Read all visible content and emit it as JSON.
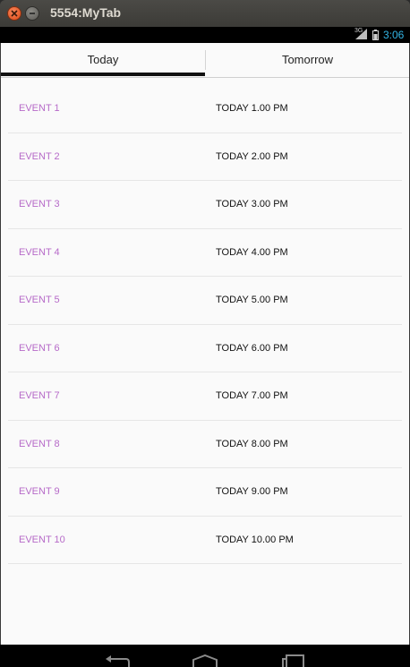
{
  "window": {
    "title": "5554:MyTab"
  },
  "statusbar": {
    "network": "3G",
    "time": "3:06",
    "time_color": "#33b5e5"
  },
  "tabs": [
    {
      "label": "Today",
      "selected": true
    },
    {
      "label": "Tomorrow",
      "selected": false
    }
  ],
  "events": [
    {
      "name": "EVENT 1",
      "time": "TODAY 1.00 PM"
    },
    {
      "name": "EVENT 2",
      "time": "TODAY 2.00 PM"
    },
    {
      "name": "EVENT 3",
      "time": "TODAY 3.00 PM"
    },
    {
      "name": "EVENT 4",
      "time": "TODAY 4.00 PM"
    },
    {
      "name": "EVENT 5",
      "time": "TODAY 5.00 PM"
    },
    {
      "name": "EVENT 6",
      "time": "TODAY 6.00 PM"
    },
    {
      "name": "EVENT 7",
      "time": "TODAY 7.00 PM"
    },
    {
      "name": "EVENT 8",
      "time": "TODAY 8.00 PM"
    },
    {
      "name": "EVENT 9",
      "time": "TODAY 9.00 PM"
    },
    {
      "name": "EVENT 10",
      "time": "TODAY 10.00 PM"
    }
  ],
  "colors": {
    "event_name": "#b66ac8",
    "tab_indicator": "#111111",
    "close_button": "#de4a16"
  },
  "navbar": {
    "icons": [
      "back-icon",
      "home-icon",
      "recent-apps-icon"
    ]
  }
}
